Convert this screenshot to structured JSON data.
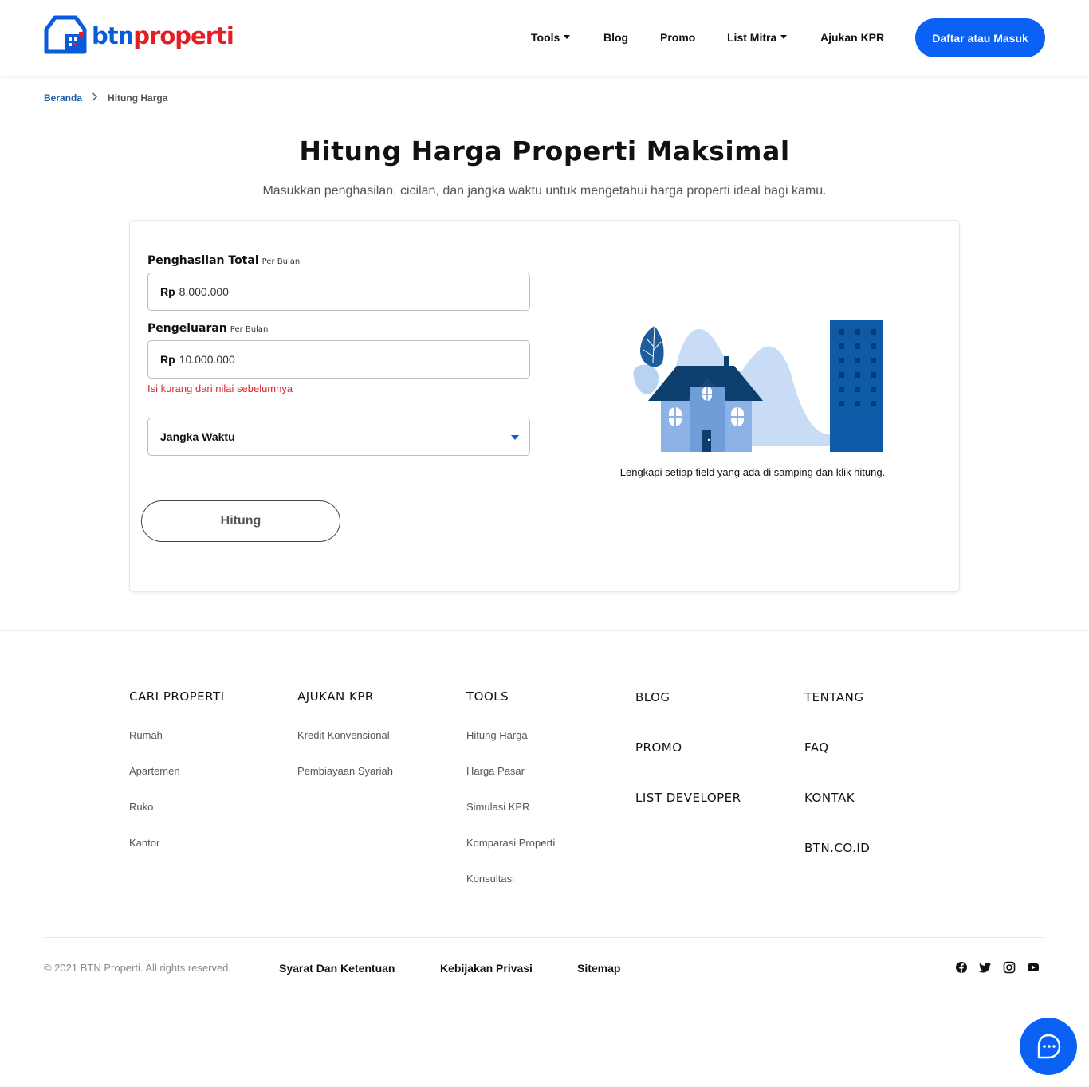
{
  "header": {
    "logo": {
      "part1": "btn",
      "part2": "properti"
    },
    "nav": [
      {
        "label": "Tools",
        "dropdown": true
      },
      {
        "label": "Blog",
        "dropdown": false
      },
      {
        "label": "Promo",
        "dropdown": false
      },
      {
        "label": "List Mitra",
        "dropdown": true
      },
      {
        "label": "Ajukan KPR",
        "dropdown": false
      }
    ],
    "cta_label": "Daftar atau Masuk"
  },
  "breadcrumb": {
    "home": "Beranda",
    "current": "Hitung Harga"
  },
  "main": {
    "title": "Hitung Harga Properti Maksimal",
    "subtitle": "Masukkan penghasilan, cicilan, dan jangka waktu untuk mengetahui harga properti ideal bagi kamu."
  },
  "form": {
    "income": {
      "label": "Penghasilan Total",
      "sub": "Per Bulan",
      "prefix": "Rp",
      "value": "8.000.000"
    },
    "expense": {
      "label": "Pengeluaran",
      "sub": "Per Bulan",
      "prefix": "Rp",
      "value": "10.000.000",
      "error": "Isi kurang dari nilai sebelumnya"
    },
    "term": {
      "placeholder": "Jangka Waktu"
    },
    "submit_label": "Hitung"
  },
  "result": {
    "hint": "Lengkapi setiap field yang ada di samping dan klik hitung."
  },
  "footer": {
    "columns": [
      {
        "title": "CARI PROPERTI",
        "links": [
          "Rumah",
          "Apartemen",
          "Ruko",
          "Kantor"
        ]
      },
      {
        "title": "AJUKAN KPR",
        "links": [
          "Kredit Konvensional",
          "Pembiayaan Syariah"
        ]
      },
      {
        "title": "TOOLS",
        "links": [
          "Hitung Harga",
          "Harga Pasar",
          "Simulasi KPR",
          "Komparasi Properti",
          "Konsultasi"
        ]
      }
    ],
    "col4": [
      "BLOG",
      "PROMO",
      "LIST DEVELOPER"
    ],
    "col5": [
      "TENTANG",
      "FAQ",
      "KONTAK",
      "BTN.CO.ID"
    ],
    "copyright": "© 2021 BTN Properti. All rights reserved.",
    "legal": [
      "Syarat Dan Ketentuan",
      "Kebijakan Privasi",
      "Sitemap"
    ],
    "social": [
      "facebook-icon",
      "twitter-icon",
      "instagram-icon",
      "youtube-icon"
    ]
  },
  "colors": {
    "brand_blue": "#0a61f4",
    "brand_red": "#e31f26",
    "error": "#e3262c"
  }
}
